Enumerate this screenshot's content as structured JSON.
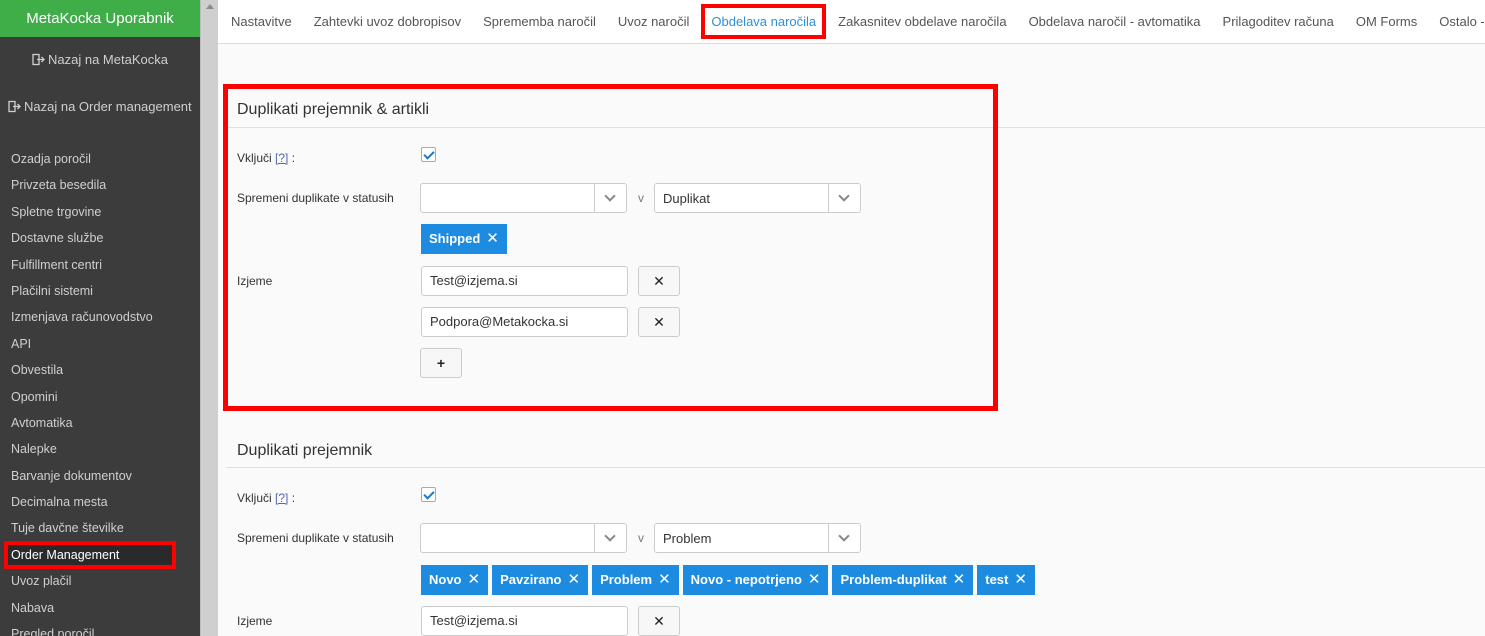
{
  "sidebar": {
    "title": "MetaKocka Uporabnik",
    "back_metakocka": "Nazaj na MetaKocka",
    "back_order_management": "Nazaj na Order management",
    "items": [
      {
        "label": "Ozadja poročil"
      },
      {
        "label": "Privzeta besedila"
      },
      {
        "label": "Spletne trgovine"
      },
      {
        "label": "Dostavne službe"
      },
      {
        "label": "Fulfillment centri"
      },
      {
        "label": "Plačilni sistemi"
      },
      {
        "label": "Izmenjava računovodstvo"
      },
      {
        "label": "API"
      },
      {
        "label": "Obvestila"
      },
      {
        "label": "Opomini"
      },
      {
        "label": "Avtomatika"
      },
      {
        "label": "Nalepke"
      },
      {
        "label": "Barvanje dokumentov"
      },
      {
        "label": "Decimalna mesta"
      },
      {
        "label": "Tuje davčne številke"
      },
      {
        "label": "Order Management"
      },
      {
        "label": "Uvoz plačil"
      },
      {
        "label": "Nabava"
      },
      {
        "label": "Pregled poročil"
      }
    ]
  },
  "tabs": [
    {
      "label": "Nastavitve"
    },
    {
      "label": "Zahtevki uvoz dobropisov"
    },
    {
      "label": "Sprememba naročil"
    },
    {
      "label": "Uvoz naročil"
    },
    {
      "label": "Obdelava naročila"
    },
    {
      "label": "Zakasnitev obdelave naročila"
    },
    {
      "label": "Obdelava naročil - avtomatika"
    },
    {
      "label": "Prilagoditev računa"
    },
    {
      "label": "OM Forms"
    },
    {
      "label": "Ostalo - zahtev"
    }
  ],
  "section1": {
    "title": "Duplikati prejemnik & artikli",
    "enable_label": "Vključi",
    "help": "[?]",
    "colon": ":",
    "status_label": "Spremeni duplikate v statusih",
    "status_value": "",
    "v": "v",
    "target_status": "Duplikat",
    "tags": [
      {
        "label": "Shipped"
      }
    ],
    "exceptions_label": "Izjeme",
    "exceptions": [
      "Test@izjema.si",
      "Podpora@Metakocka.si"
    ],
    "remove": "✕",
    "add": "+"
  },
  "section2": {
    "title": "Duplikati prejemnik",
    "enable_label": "Vključi",
    "help": "[?]",
    "colon": ":",
    "status_label": "Spremeni duplikate v statusih",
    "status_value": "",
    "v": "v",
    "target_status": "Problem",
    "tags": [
      {
        "label": "Novo"
      },
      {
        "label": "Pavzirano"
      },
      {
        "label": "Problem"
      },
      {
        "label": "Novo - nepotrjeno"
      },
      {
        "label": "Problem-duplikat"
      },
      {
        "label": "test"
      }
    ],
    "exceptions_label": "Izjeme",
    "exceptions": [
      "Test@izjema.si"
    ],
    "remove": "✕"
  },
  "colors": {
    "sidebar_bg": "#3c3c3c",
    "header_green": "#3fae49",
    "tag_blue": "#1d8ce0",
    "highlight_red": "#ff0000",
    "active_tab": "#2f8fd8"
  }
}
